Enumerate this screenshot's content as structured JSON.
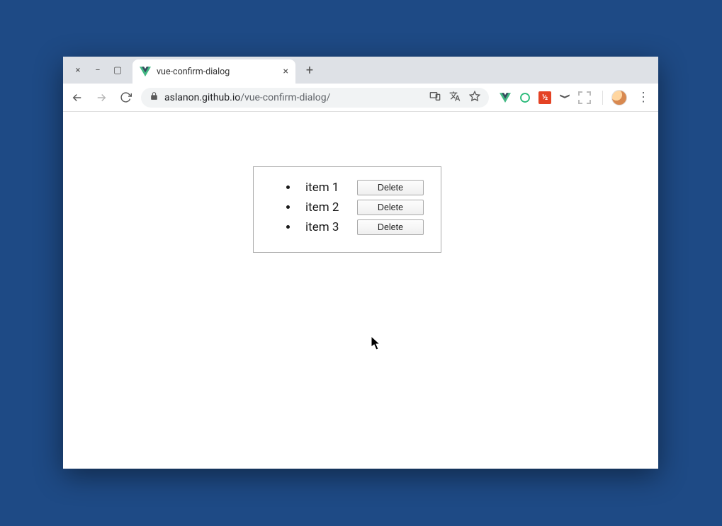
{
  "window": {
    "controls": {
      "close": "×",
      "minimize": "−",
      "maximize": "▢"
    }
  },
  "tab": {
    "title": "vue-confirm-dialog",
    "close": "×",
    "newtab": "+"
  },
  "address": {
    "domain": "aslanon.github.io",
    "path": "/vue-confirm-dialog/"
  },
  "toolbar_icons": {
    "back": "back-icon",
    "forward": "forward-icon",
    "reload": "reload-icon",
    "lock": "lock-icon",
    "devices": "devices-icon",
    "translate": "translate-icon",
    "star": "star-icon",
    "vue": "vue-icon",
    "circle": "circle-ext-icon",
    "red": "red-ext-icon",
    "shape": "shape-ext-icon",
    "square": "square-ext-icon",
    "avatar": "avatar-icon",
    "menu": "menu-icon"
  },
  "list": {
    "items": [
      {
        "label": "item 1",
        "button": "Delete"
      },
      {
        "label": "item 2",
        "button": "Delete"
      },
      {
        "label": "item 3",
        "button": "Delete"
      }
    ]
  }
}
